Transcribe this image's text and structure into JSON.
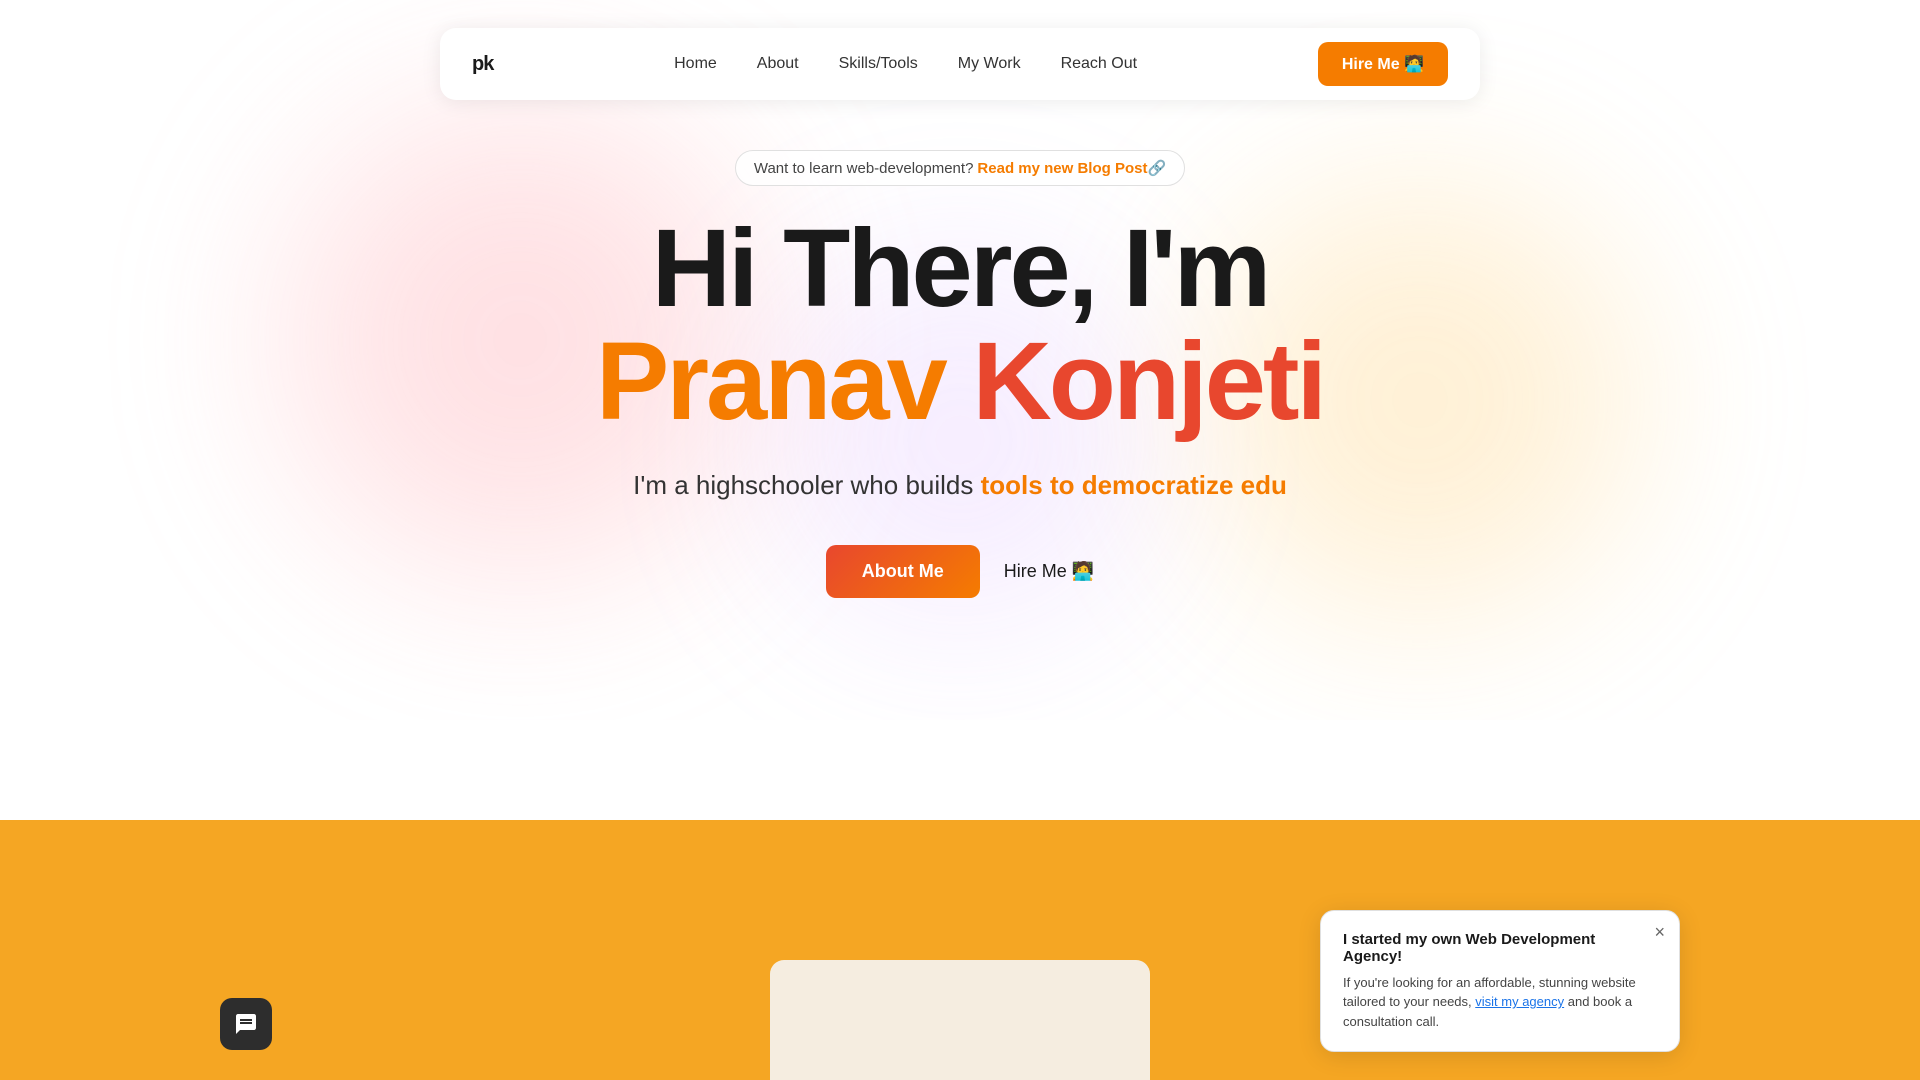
{
  "navbar": {
    "logo": "pk",
    "links": [
      {
        "label": "Home",
        "href": "#"
      },
      {
        "label": "About",
        "href": "#"
      },
      {
        "label": "Skills/Tools",
        "href": "#"
      },
      {
        "label": "My Work",
        "href": "#"
      },
      {
        "label": "Reach Out",
        "href": "#"
      }
    ],
    "hire_button": "Hire Me 🧑‍💻"
  },
  "hero": {
    "pill_text": "Want to learn web-development?",
    "pill_link": "Read my new Blog Post🔗",
    "line1": "Hi There, I'm",
    "name_pranav": "Pranav",
    "name_konjeti": "Konjeti",
    "subtitle_prefix": "I'm a highschooler who builds ",
    "subtitle_highlight": "tools to democratize edu",
    "cta_about": "About Me",
    "cta_hire": "Hire Me 🧑‍💻"
  },
  "popup": {
    "title": "I started my own Web Development Agency!",
    "text_prefix": "If you're looking for an affordable, stunning website tailored to your needs, ",
    "link_text": "visit my agency",
    "text_suffix": " and book a consultation call.",
    "close": "×"
  }
}
